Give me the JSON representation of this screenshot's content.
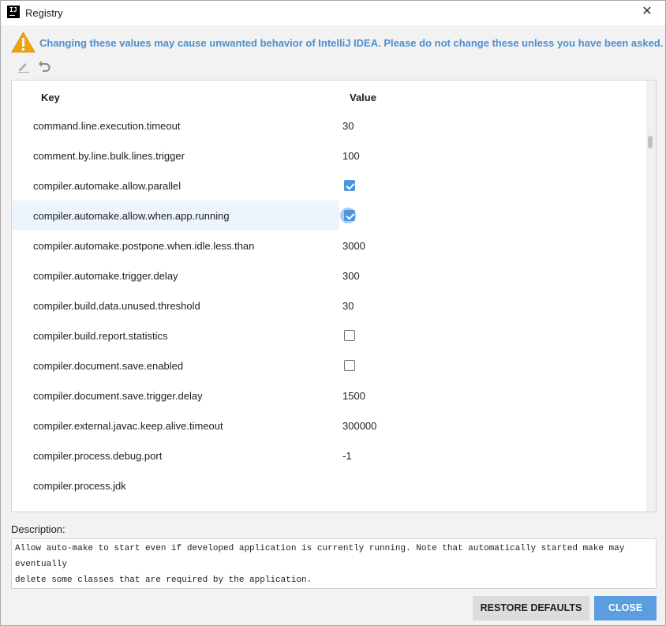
{
  "window": {
    "title": "Registry",
    "logo_text": "IJ"
  },
  "warning": {
    "text": "Changing these values may cause unwanted behavior of IntelliJ IDEA. Please do not change these unless you have been asked.",
    "color": "#4a90d0"
  },
  "toolbar": {
    "edit_icon": "pencil-icon",
    "revert_icon": "undo-icon"
  },
  "table": {
    "columns": {
      "key": "Key",
      "value": "Value"
    },
    "rows": [
      {
        "key": "command.line.execution.timeout",
        "value": "30",
        "type": "text"
      },
      {
        "key": "comment.by.line.bulk.lines.trigger",
        "value": "100",
        "type": "text"
      },
      {
        "key": "compiler.automake.allow.parallel",
        "checked": true,
        "type": "checkbox"
      },
      {
        "key": "compiler.automake.allow.when.app.running",
        "checked": true,
        "type": "checkbox",
        "selected": true
      },
      {
        "key": "compiler.automake.postpone.when.idle.less.than",
        "value": "3000",
        "type": "text"
      },
      {
        "key": "compiler.automake.trigger.delay",
        "value": "300",
        "type": "text"
      },
      {
        "key": "compiler.build.data.unused.threshold",
        "value": "30",
        "type": "text"
      },
      {
        "key": "compiler.build.report.statistics",
        "checked": false,
        "type": "checkbox"
      },
      {
        "key": "compiler.document.save.enabled",
        "checked": false,
        "type": "checkbox"
      },
      {
        "key": "compiler.document.save.trigger.delay",
        "value": "1500",
        "type": "text"
      },
      {
        "key": "compiler.external.javac.keep.alive.timeout",
        "value": "300000",
        "type": "text"
      },
      {
        "key": "compiler.process.debug.port",
        "value": "-1",
        "type": "text"
      },
      {
        "key": "compiler.process.jdk",
        "value": "",
        "type": "text"
      }
    ]
  },
  "description": {
    "label": "Description:",
    "text": "Allow auto-make to start even if developed application is currently running. Note that automatically started make may eventually\ndelete some classes that are required by the application."
  },
  "buttons": {
    "restore": "RESTORE DEFAULTS",
    "close": "CLOSE"
  },
  "colors": {
    "accent": "#5a9ee0",
    "checkbox_checked": "#4d95de",
    "selected_row": "#edf4fc"
  }
}
